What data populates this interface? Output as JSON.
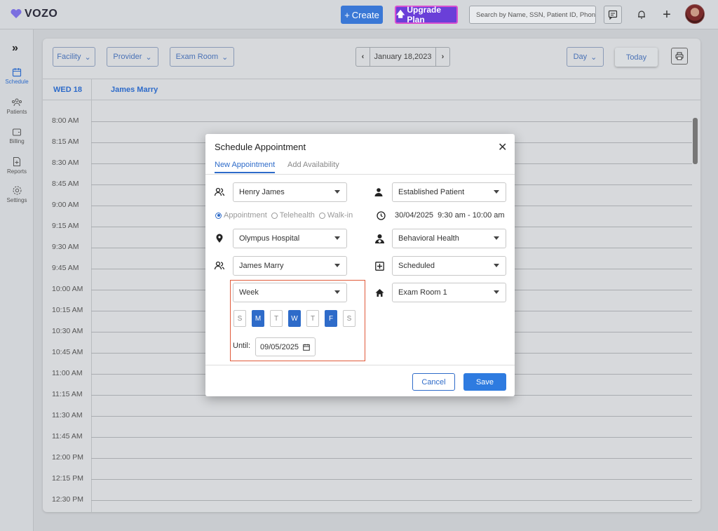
{
  "app": {
    "name": "VOZO"
  },
  "topbar": {
    "create_label": "Create",
    "upgrade_label": "Upgrade Plan",
    "search_placeholder": "Search by Name, SSN, Patient ID, Phon",
    "create_color": "#3a78d6",
    "upgrade_color": "#6a3fd8"
  },
  "sidebar": {
    "toggle": "»",
    "items": [
      {
        "label": "Schedule",
        "icon": "calendar-icon",
        "active": true
      },
      {
        "label": "Patients",
        "icon": "users-icon"
      },
      {
        "label": "Billing",
        "icon": "wallet-icon"
      },
      {
        "label": "Reports",
        "icon": "report-icon"
      },
      {
        "label": "Settings",
        "icon": "gear-icon"
      }
    ]
  },
  "toolbar": {
    "facility": "Facility",
    "provider": "Provider",
    "exam_room": "Exam Room",
    "date": "January 18,2023",
    "view": "Day",
    "today": "Today"
  },
  "calendar": {
    "day_header": "WED 18",
    "provider": "James Marry",
    "slots": [
      "8:00 AM",
      "8:15 AM",
      "8:30 AM",
      "8:45 AM",
      "9:00 AM",
      "9:15 AM",
      "9:30 AM",
      "9:45 AM",
      "10:00 AM",
      "10:15 AM",
      "10:30 AM",
      "10:45 AM",
      "11:00 AM",
      "11:15 AM",
      "11:30 AM",
      "11:45 AM",
      "12:00 PM",
      "12:15 PM",
      "12:30 PM"
    ]
  },
  "modal": {
    "title": "Schedule Appointment",
    "tabs": [
      "New Appointment",
      "Add Availability"
    ],
    "patient": "Henry James",
    "patient_type": "Established Patient",
    "appt_types": [
      "Appointment",
      "Telehealth",
      "Walk-in"
    ],
    "datetime": "30/04/2025  9:30 am - 10:00 am",
    "location": "Olympus Hospital",
    "specialty": "Behavioral Health",
    "provider": "James Marry",
    "status": "Scheduled",
    "repeat": "Week",
    "room": "Exam Room 1",
    "days": [
      {
        "label": "S",
        "on": false
      },
      {
        "label": "M",
        "on": true
      },
      {
        "label": "T",
        "on": false
      },
      {
        "label": "W",
        "on": true
      },
      {
        "label": "T",
        "on": false
      },
      {
        "label": "F",
        "on": true
      },
      {
        "label": "S",
        "on": false
      }
    ],
    "until_label": "Until:",
    "until_date": "09/05/2025",
    "cancel": "Cancel",
    "save": "Save",
    "accent_color": "#2e6bc9"
  }
}
